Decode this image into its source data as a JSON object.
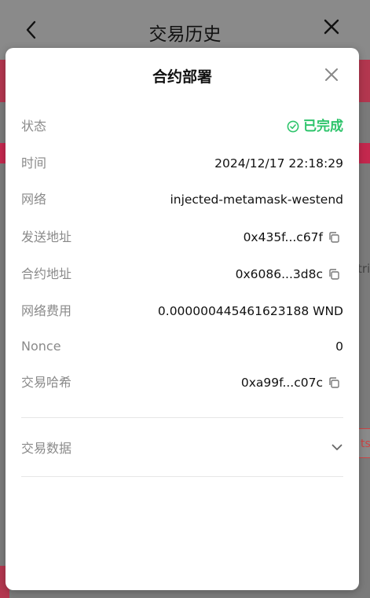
{
  "background": {
    "header_title": "交易历史",
    "side_text": "tri",
    "side_button": "ts"
  },
  "modal": {
    "title": "合约部署",
    "rows": [
      {
        "label": "状态",
        "value": "已完成"
      },
      {
        "label": "时间",
        "value": "2024/12/17 22:18:29"
      },
      {
        "label": "网络",
        "value": "injected-metamask-westend"
      },
      {
        "label": "发送地址",
        "value": "0x435f...c67f"
      },
      {
        "label": "合约地址",
        "value": "0x6086...3d8c"
      },
      {
        "label": "网络费用",
        "value": "0.000000445461623188 WND"
      },
      {
        "label": "Nonce",
        "value": "0"
      },
      {
        "label": "交易哈希",
        "value": "0xa99f...c07c"
      }
    ],
    "transaction_data_label": "交易数据"
  },
  "colors": {
    "success": "#2ec46b",
    "label": "#8a8a8a",
    "banner": "#b3374f"
  }
}
